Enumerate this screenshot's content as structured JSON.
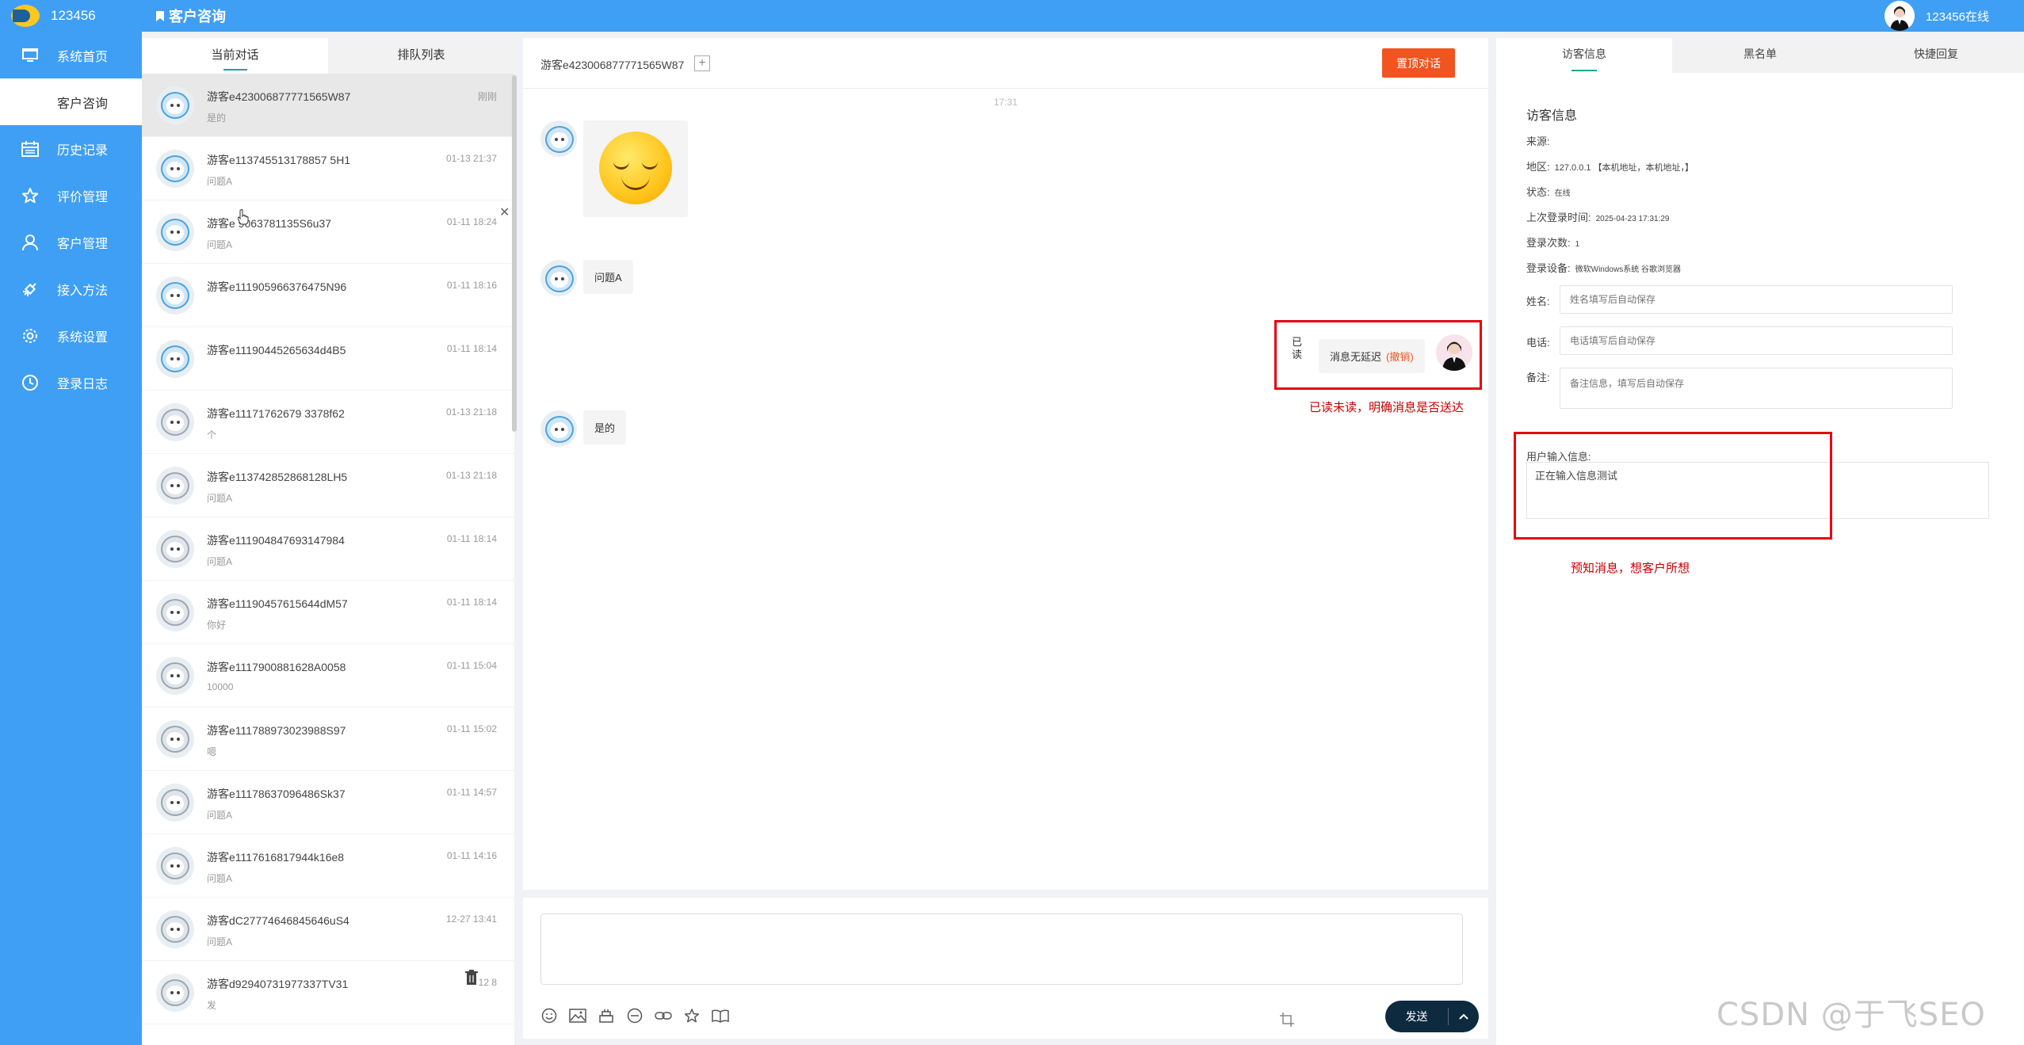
{
  "brand": {
    "name": "123456"
  },
  "header": {
    "title": "客户咨询",
    "user_status": "123456在线"
  },
  "nav": [
    {
      "label": "系统首页",
      "icon": "monitor-icon"
    },
    {
      "label": "客户咨询",
      "icon": "",
      "active": true
    },
    {
      "label": "历史记录",
      "icon": "calendar-icon"
    },
    {
      "label": "评价管理",
      "icon": "star-icon"
    },
    {
      "label": "客户管理",
      "icon": "user-icon"
    },
    {
      "label": "接入方法",
      "icon": "plugin-icon"
    },
    {
      "label": "系统设置",
      "icon": "gear-icon"
    },
    {
      "label": "登录日志",
      "icon": "clock-icon"
    }
  ],
  "list_tabs": [
    {
      "label": "当前对话",
      "active": true
    },
    {
      "label": "排队列表",
      "active": false
    }
  ],
  "conversations": [
    {
      "name": "游客e423006877771565W87",
      "preview": "是的",
      "time": "刚刚",
      "active": true,
      "color": true
    },
    {
      "name": "游客e113745513178857 5H1",
      "preview": "问题A",
      "time": "01-13 21:37",
      "color": true
    },
    {
      "name": "游客e   9063781135S6u37",
      "preview": "问题A",
      "time": "01-11 18:24",
      "color": true
    },
    {
      "name": "游客e111905966376475N96",
      "preview": "",
      "time": "01-11 18:16",
      "color": true
    },
    {
      "name": "游客e11190445265634d4B5",
      "preview": "",
      "time": "01-11 18:14",
      "color": true
    },
    {
      "name": "游客e11171762679 3378f62",
      "preview": "个",
      "time": "01-13 21:18",
      "color": false
    },
    {
      "name": "游客e113742852868128LH5",
      "preview": "问题A",
      "time": "01-13 21:18",
      "color": false
    },
    {
      "name": "游客e111904847693147984",
      "preview": "问题A",
      "time": "01-11 18:14",
      "color": false
    },
    {
      "name": "游客e11190457615644dM57",
      "preview": "你好",
      "time": "01-11 18:14",
      "color": false
    },
    {
      "name": "游客e1117900881628A0058",
      "preview": "10000",
      "time": "01-11 15:04",
      "color": false
    },
    {
      "name": "游客e111788973023988S97",
      "preview": "嗯",
      "time": "01-11 15:02",
      "color": false
    },
    {
      "name": "游客e11178637096486Sk37",
      "preview": "问题A",
      "time": "01-11 14:57",
      "color": false
    },
    {
      "name": "游客e1117616817944k16e8",
      "preview": "问题A",
      "time": "01-11 14:16",
      "color": false
    },
    {
      "name": "游客dC27774646845646uS4",
      "preview": "问题A",
      "time": "12-27 13:41",
      "color": false
    },
    {
      "name": "游客d92940731977337TV31",
      "preview": "发",
      "time": "12       8",
      "color": false
    }
  ],
  "chat": {
    "visitor": "游客e423006877771565W87",
    "close_button": "置顶对话",
    "time_divider": "17:31",
    "msg_question": "问题A",
    "msg_yes": "是的",
    "read_label": "已读",
    "self_msg": "消息无延迟",
    "recall": "(撤销)",
    "annotation": "已读未读，明确消息是否送达"
  },
  "composer": {
    "send": "发送"
  },
  "info_tabs": [
    {
      "label": "访客信息",
      "active": true
    },
    {
      "label": "黑名单",
      "active": false
    },
    {
      "label": "快捷回复",
      "active": false
    }
  ],
  "info": {
    "title": "访客信息",
    "source_label": "来源:",
    "region_label": "地区:",
    "region_value": "127.0.0.1 【本机地址，本机地址，】",
    "status_label": "状态:",
    "status_value": "在线",
    "last_login_label": "上次登录时间:",
    "last_login_value": "2025-04-23 17:31:29",
    "login_count_label": "登录次数:",
    "login_count_value": "1",
    "device_label": "登录设备:",
    "device_value": "微软Windows系统 谷歌浏览器",
    "name_label": "姓名:",
    "name_placeholder": "姓名填写后自动保存",
    "phone_label": "电话:",
    "phone_placeholder": "电话填写后自动保存",
    "note_label": "备注:",
    "note_placeholder": "备注信息，填写后自动保存",
    "typing_label": "用户输入信息:",
    "typing_value": "正在输入信息测试",
    "annotation": "预知消息，想客户所想"
  },
  "watermark": "CSDN @于飞SEO",
  "colors": {
    "primary": "#3f9ff5",
    "danger": "#f0541f",
    "annotation": "#c40000",
    "tab_underline": "#1ba39c"
  }
}
